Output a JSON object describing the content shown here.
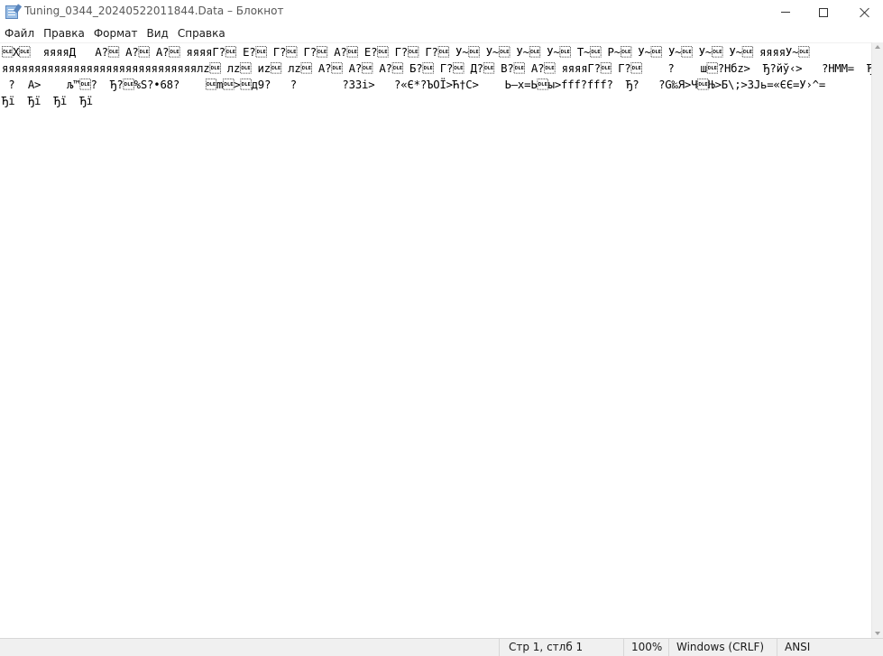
{
  "window": {
    "title": "Tuning_0344_20240522011844.Data – Блокнот",
    "minimize_icon": "minimize-icon",
    "maximize_icon": "maximize-icon",
    "close_icon": "close-icon"
  },
  "menu": {
    "items": [
      "Файл",
      "Правка",
      "Формат",
      "Вид",
      "Справка"
    ]
  },
  "editor": {
    "lines": [
      "\u0010X\u0010  яяяяД   А?\u0010 А?\u0010 А?\u0010 яяяяГ?\u0010 Е?\u0010 Г?\u0010 Г?\u0010 А?\u0010 Е?\u0010 Г?\u0010 Г?\u0010 У~\u0010 У~\u0010 У~\u0010 У~\u0010 Т~\u0010 Р~\u0010 У~\u0010 У~\u0010 У~\u0010 У~\u0010 яяяяУ~\u0010",
      "яяяяяяяяяяяяяяяяяяяяяяяяяяяяяялz\u0010 лz\u0010 иz\u0010 лz\u0010 А?\u0010 А?\u0010 А?\u0010 Б?\u0010 Г?\u0010 Д?\u0010 В?\u0010 А?\u0010 яяяяГ?\u0010 Г?\u0010    ?    ш\u0010?Нбz>  Ђ?йў‹>   ?НММ=  Ђ?\u0010/Ы;  Ђ?",
      " ?  А>    љ™\u0010?  Ђ?\u0010%S?•68?    \u0010m\u0010>\u0010д9?   ?       ?33i>   ?«Є*?ЪОЇ>Ћ†С>    Ь—х=Ь\u0010ы>fff?fff?  Ђ?   ?G‰Я>Ч\u0010Њ>Б\\;>ЗЈь=«ЄЄ=У›^=",
      "Ђї  Ђї  Ђї  Ђї"
    ]
  },
  "statusbar": {
    "position": "Стр 1, стлб 1",
    "zoom": "100%",
    "line_endings": "Windows (CRLF)",
    "encoding": "ANSI"
  }
}
